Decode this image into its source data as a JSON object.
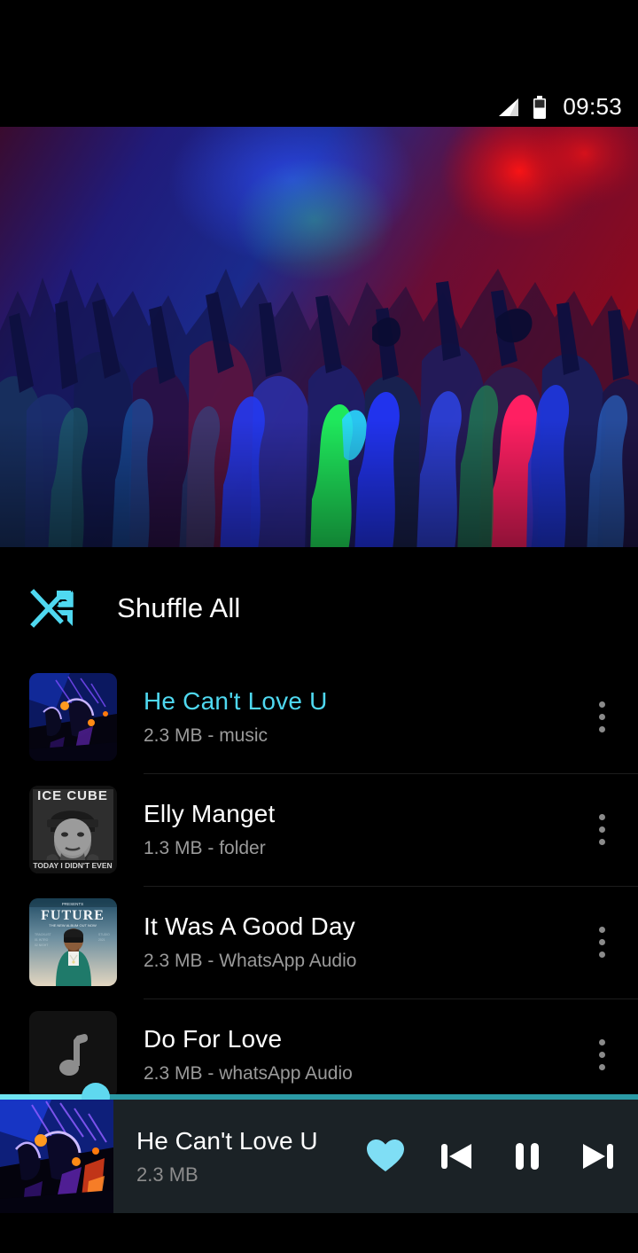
{
  "status_bar": {
    "time": "09:53",
    "signal_icon": "signal-bars-icon",
    "battery_icon": "battery-icon"
  },
  "hero": {
    "name": "concert-crowd-banner",
    "alt": "Concert crowd silhouettes with neon lights"
  },
  "shuffle": {
    "icon": "shuffle-icon",
    "label": "Shuffle All",
    "color": "#4fd8f0"
  },
  "tracks": [
    {
      "title": "He Can't Love U",
      "subtitle": "2.3 MB - music",
      "active": true,
      "artwork": "neon-concert-art",
      "overflow_icon": "more-vertical-icon"
    },
    {
      "title": "Elly Manget",
      "subtitle": "1.3 MB - folder",
      "active": false,
      "artwork": "ice-cube-album-art",
      "overflow_icon": "more-vertical-icon"
    },
    {
      "title": "It Was A Good Day",
      "subtitle": "2.3 MB - WhatsApp Audio",
      "active": false,
      "artwork": "future-poster-art",
      "overflow_icon": "more-vertical-icon"
    },
    {
      "title": "Do For Love",
      "subtitle": "2.3 MB - whatsApp Audio",
      "active": false,
      "artwork": "music-note-placeholder",
      "overflow_icon": "more-vertical-icon"
    }
  ],
  "player": {
    "artwork": "neon-concert-art",
    "title": "He Can't Love U",
    "subtitle": "2.3 MB",
    "favorite_icon": "heart-icon",
    "favorite_active": true,
    "previous_icon": "skip-previous-icon",
    "play_pause_icon": "pause-icon",
    "next_icon": "skip-next-icon",
    "progress_percent": 15
  },
  "colors": {
    "accent": "#4fd8f0",
    "progress_track": "#2b9aa5",
    "progress_thumb": "#5fd8ef",
    "player_bg": "#1b2226",
    "page_bg": "#000000",
    "secondary_text": "#9a9a9a"
  }
}
